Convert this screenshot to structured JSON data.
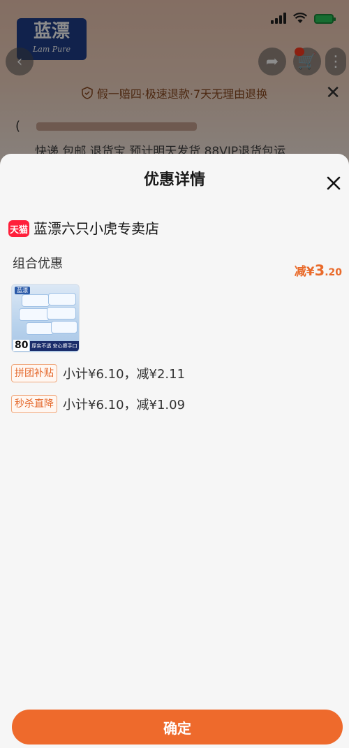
{
  "background_page": {
    "brand_logo_cn": "蓝漂",
    "brand_logo_en": "Lam Pure",
    "guarantee_text": "假一赔四·极速退款·7天无理由退换",
    "service_text": "快递 包邮 退货宝 预计明天发货 88VIP退货包运"
  },
  "sheet": {
    "title": "优惠详情",
    "store": {
      "badge": "天猫",
      "name": "蓝漂六只小虎专卖店"
    },
    "combo": {
      "label": "组合优惠",
      "discount_prefix": "减¥",
      "discount_int": "3",
      "discount_dec": ".20"
    },
    "product": {
      "logo": "蓝漂",
      "count": "80",
      "strip_text": "厚实不透 安心擦手口"
    },
    "promotions": [
      {
        "tag": "拼团补贴",
        "detail": "小计¥6.10，减¥2.11"
      },
      {
        "tag": "秒杀直降",
        "detail": "小计¥6.10，减¥1.09"
      }
    ],
    "confirm_label": "确定"
  },
  "colors": {
    "accent": "#ee6a2c",
    "tmall_red": "#ff1f3a",
    "sheet_bg": "#f6f6f6"
  }
}
